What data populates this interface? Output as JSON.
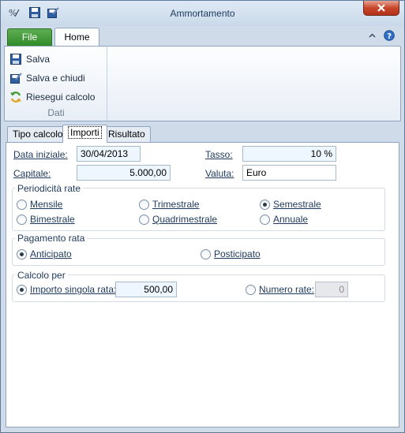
{
  "window": {
    "title": "Ammortamento"
  },
  "quick_access": [
    {
      "icon": "calculator-icon"
    },
    {
      "icon": "save-icon"
    },
    {
      "icon": "save-close-icon"
    }
  ],
  "ribbon": {
    "file_tab": "File",
    "home_tab": "Home",
    "buttons": {
      "save": "Salva",
      "save_close": "Salva e chiudi",
      "recalc": "Riesegui calcolo"
    },
    "group_label": "Dati"
  },
  "tabs": [
    {
      "label": "Tipo calcolo"
    },
    {
      "label": "Importi"
    },
    {
      "label": "Risultato"
    }
  ],
  "form": {
    "data_iniziale_label": "Data iniziale:",
    "data_iniziale_value": "30/04/2013",
    "tasso_label": "Tasso:",
    "tasso_value": "10  %",
    "capitale_label": "Capitale:",
    "capitale_value": "5.000,00",
    "valuta_label": "Valuta:",
    "valuta_value": "Euro"
  },
  "periodicita": {
    "title": "Periodicità rate",
    "options": [
      "Mensile",
      "Trimestrale",
      "Semestrale",
      "Bimestrale",
      "Quadrimestrale",
      "Annuale"
    ],
    "selected": "Semestrale"
  },
  "pagamento": {
    "title": "Pagamento rata",
    "options": [
      "Anticipato",
      "Posticipato"
    ],
    "selected": "Anticipato"
  },
  "calcolo": {
    "title": "Calcolo per",
    "importo_label": "Importo singola rata:",
    "importo_value": "500,00",
    "numero_label": "Numero rate:",
    "numero_value": "0",
    "selected": "Importo singola rata"
  }
}
